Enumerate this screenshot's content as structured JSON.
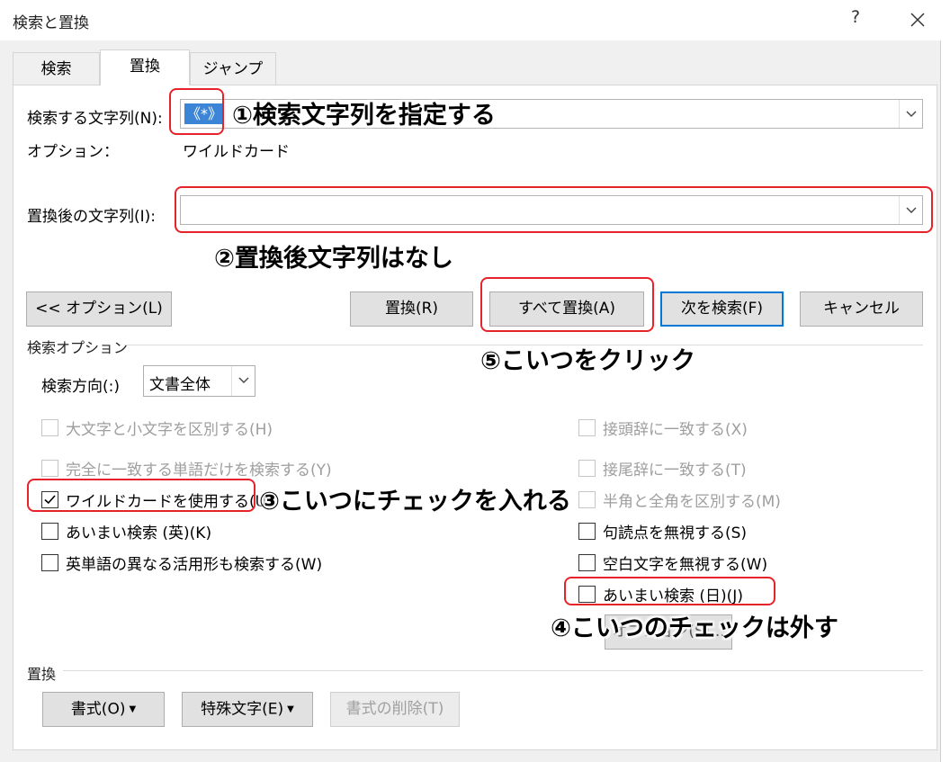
{
  "window": {
    "title": "検索と置換",
    "help": "?"
  },
  "tabs": [
    "検索",
    "置換",
    "ジャンプ"
  ],
  "find": {
    "label": "検索する文字列(N):",
    "value": "《*》",
    "options_label": "オプション：",
    "options_value": "ワイルドカード"
  },
  "replace": {
    "label": "置換後の文字列(I):",
    "value": ""
  },
  "buttons": {
    "options": "<< オプション(L)",
    "replace": "置換(R)",
    "replace_all": "すべて置換(A)",
    "find_next": "次を検索(F)",
    "cancel": "キャンセル"
  },
  "search_options": {
    "section_label": "検索オプション",
    "direction_label": "検索方向(:)",
    "direction_value": "文書全体",
    "left": [
      {
        "label": "大文字と小文字を区別する(H)",
        "checked": false,
        "disabled": true
      },
      {
        "label": "完全に一致する単語だけを検索する(Y)",
        "checked": false,
        "disabled": true
      },
      {
        "label": "ワイルドカードを使用する(U)",
        "checked": true,
        "disabled": false
      },
      {
        "label": "あいまい検索 (英)(K)",
        "checked": false,
        "disabled": false
      },
      {
        "label": "英単語の異なる活用形も検索する(W)",
        "checked": false,
        "disabled": false
      }
    ],
    "right": [
      {
        "label": "接頭辞に一致する(X)",
        "checked": false,
        "disabled": true
      },
      {
        "label": "接尾辞に一致する(T)",
        "checked": false,
        "disabled": true
      },
      {
        "label": "半角と全角を区別する(M)",
        "checked": false,
        "disabled": true
      },
      {
        "label": "句読点を無視する(S)",
        "checked": false,
        "disabled": false
      },
      {
        "label": "空白文字を無視する(W)",
        "checked": false,
        "disabled": false
      },
      {
        "label": "あいまい検索 (日)(J)",
        "checked": false,
        "disabled": false
      }
    ],
    "hidden_button": "オプション(S)..."
  },
  "replace_section": {
    "label": "置換",
    "format_button": "書式(O)",
    "special_button": "特殊文字(E)",
    "clear_format_button": "書式の削除(T)"
  },
  "annotations": {
    "step1": "①検索文字列を指定する",
    "step2": "②置換後文字列はなし",
    "step3": "③こいつにチェックを入れる",
    "step4": "④こいつのチェックは外す",
    "step5": "⑤こいつをクリック"
  },
  "colors": {
    "accent": "#0078d7",
    "highlight_red": "#e8222a",
    "selection_blue": "#3b84d6"
  }
}
